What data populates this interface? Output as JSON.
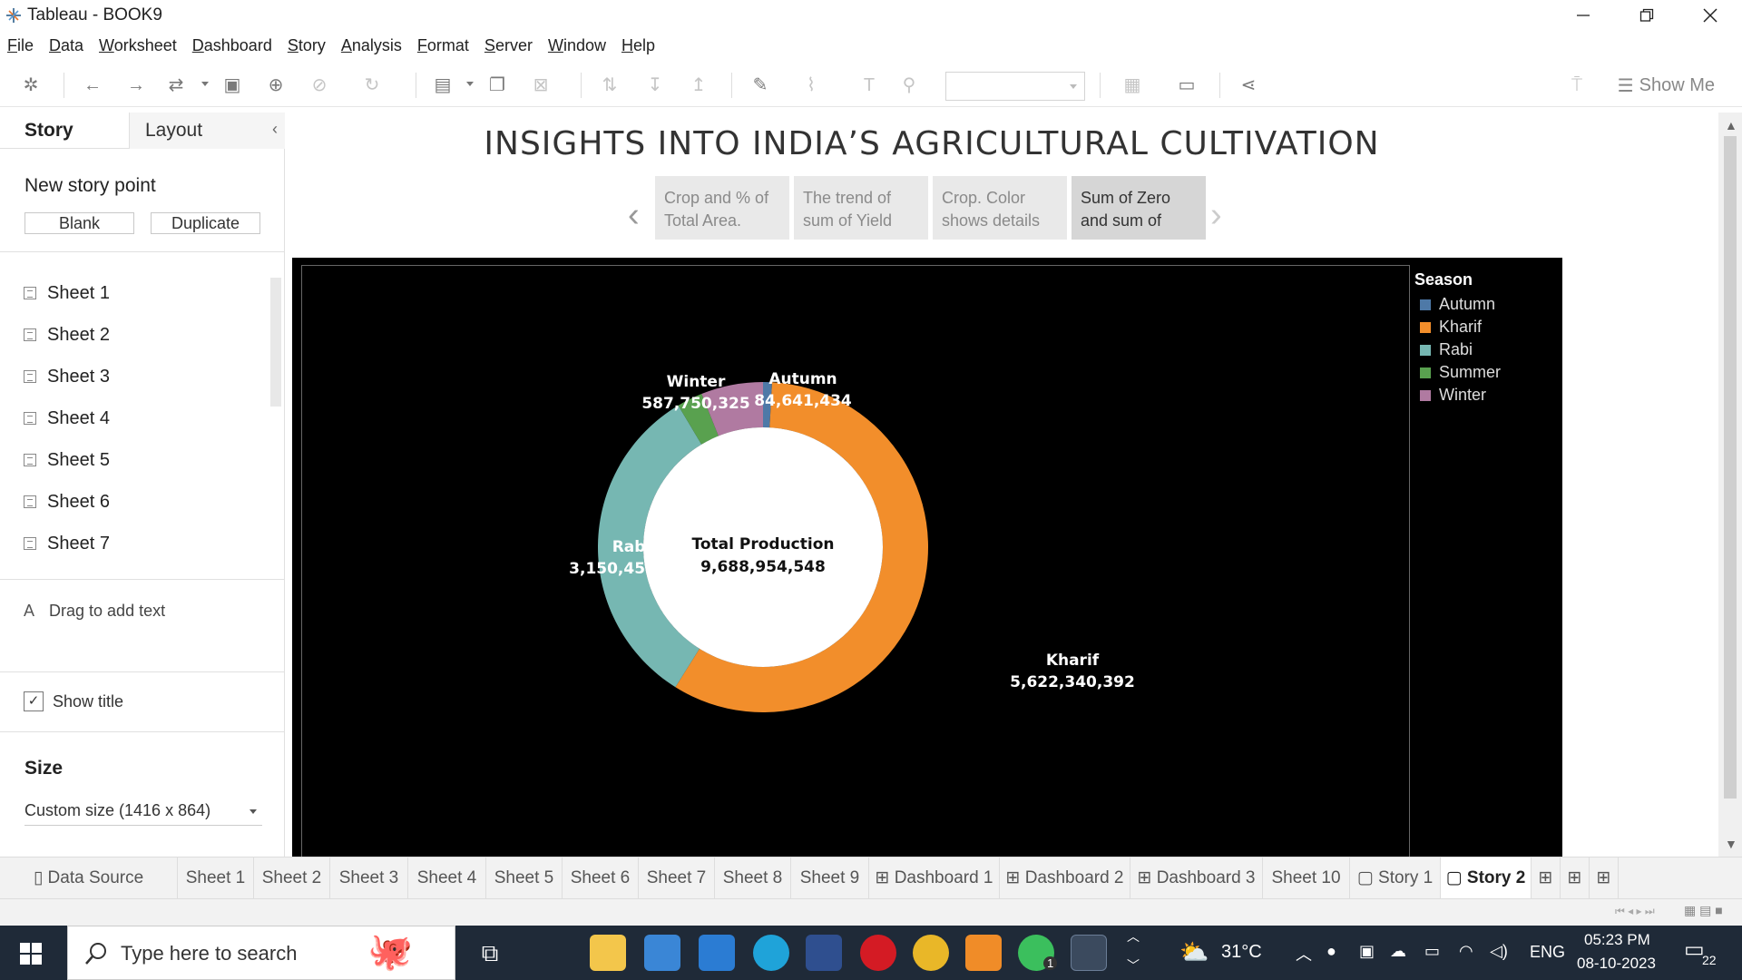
{
  "window": {
    "title": "Tableau - BOOK9"
  },
  "menu": [
    "File",
    "Data",
    "Worksheet",
    "Dashboard",
    "Story",
    "Analysis",
    "Format",
    "Server",
    "Window",
    "Help"
  ],
  "toolbar": {
    "show_me_label": "Show Me"
  },
  "left_pane": {
    "tab_story": "Story",
    "tab_layout": "Layout",
    "new_story_point": "New story point",
    "blank_label": "Blank",
    "duplicate_label": "Duplicate",
    "sheets": [
      "Sheet 1",
      "Sheet 2",
      "Sheet 3",
      "Sheet 4",
      "Sheet 5",
      "Sheet 6",
      "Sheet 7"
    ],
    "drag_text_icon": "A",
    "drag_text": "Drag to add text",
    "show_title": "Show title",
    "show_title_checked": true,
    "size_label": "Size",
    "size_value": "Custom size (1416 x 864)"
  },
  "story": {
    "title": "INSIGHTS INTO INDIA’S AGRICULTURAL CULTIVATION",
    "points": [
      {
        "line1": "Crop and % of",
        "line2": "Total Area.",
        "active": false
      },
      {
        "line1": "The trend of",
        "line2": "sum of Yield",
        "active": false
      },
      {
        "line1": "Crop.  Color",
        "line2": "shows details",
        "active": false
      },
      {
        "line1": "Sum of Zero",
        "line2": "and sum of",
        "active": true
      }
    ]
  },
  "chart_data": {
    "type": "pie",
    "style": "donut",
    "center_label": "Total Production",
    "center_value": "9,688,954,548",
    "legend_title": "Season",
    "legend_placement": "right",
    "categories": [
      "Autumn",
      "Kharif",
      "Rabi",
      "Summer",
      "Winter"
    ],
    "values": [
      84641434,
      5622340392,
      3150456464,
      243766133,
      587750325
    ],
    "value_labels": [
      "84,641,434",
      "5,622,340,392",
      "3,150,456,464",
      "",
      "587,750,325"
    ],
    "colors": [
      "#4e79a7",
      "#f28e2b",
      "#76b7b2",
      "#59a14f",
      "#b07aa1"
    ]
  },
  "bottom_tabs": [
    {
      "label": "Data Source",
      "icon": "database-icon"
    },
    {
      "label": "Sheet 1"
    },
    {
      "label": "Sheet 2"
    },
    {
      "label": "Sheet 3"
    },
    {
      "label": "Sheet 4"
    },
    {
      "label": "Sheet 5"
    },
    {
      "label": "Sheet 6"
    },
    {
      "label": "Sheet 7"
    },
    {
      "label": "Sheet 8"
    },
    {
      "label": "Sheet 9"
    },
    {
      "label": "Dashboard 1",
      "icon": "dashboard-icon"
    },
    {
      "label": "Dashboard 2",
      "icon": "dashboard-icon"
    },
    {
      "label": "Dashboard 3",
      "icon": "dashboard-icon"
    },
    {
      "label": "Sheet 10"
    },
    {
      "label": "Story 1",
      "icon": "story-icon"
    },
    {
      "label": "Story 2",
      "icon": "story-icon",
      "active": true
    }
  ],
  "taskbar": {
    "search_placeholder": "Type here to search",
    "weather": "31°C",
    "language": "ENG",
    "time": "05:23 PM",
    "date": "08-10-2023",
    "notifications": "22",
    "whatsapp_badge": "1"
  }
}
